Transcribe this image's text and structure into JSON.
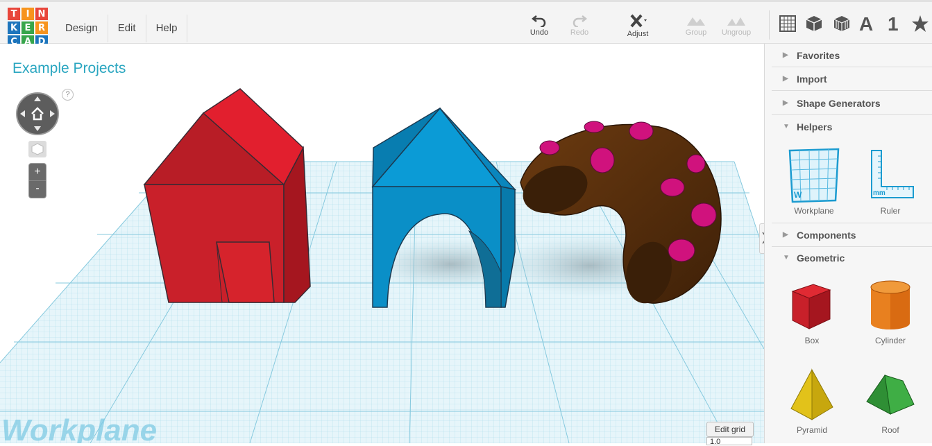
{
  "logo": {
    "letters": [
      "T",
      "I",
      "N",
      "K",
      "E",
      "R",
      "C",
      "A",
      "D"
    ]
  },
  "menu": [
    "Design",
    "Edit",
    "Help"
  ],
  "toolbar": {
    "undo": "Undo",
    "redo": "Redo",
    "adjust": "Adjust",
    "group": "Group",
    "ungroup": "Ungroup",
    "view_icons": [
      "grid-view-icon",
      "box-view-icon",
      "wire-box-icon",
      "text-icon",
      "number-icon",
      "star-icon"
    ],
    "text_label": "A",
    "number_label": "1"
  },
  "canvas": {
    "project_title": "Example Projects",
    "help": "?",
    "zoom_in": "+",
    "zoom_out": "-",
    "workplane_label": "Workplane",
    "edit_grid": "Edit grid",
    "snap_value": "1.0"
  },
  "sidebar": {
    "sections": [
      "Favorites",
      "Import",
      "Shape Generators",
      "Helpers",
      "Components",
      "Geometric"
    ],
    "helpers": [
      "Workplane",
      "Ruler"
    ],
    "geometric": [
      "Box",
      "Cylinder",
      "Pyramid",
      "Roof"
    ]
  },
  "colors": {
    "accent": "#2aa6c0",
    "red": "#d9242e",
    "blue": "#0a8fc7",
    "brown": "#5a300d",
    "magenta": "#c8117a"
  }
}
